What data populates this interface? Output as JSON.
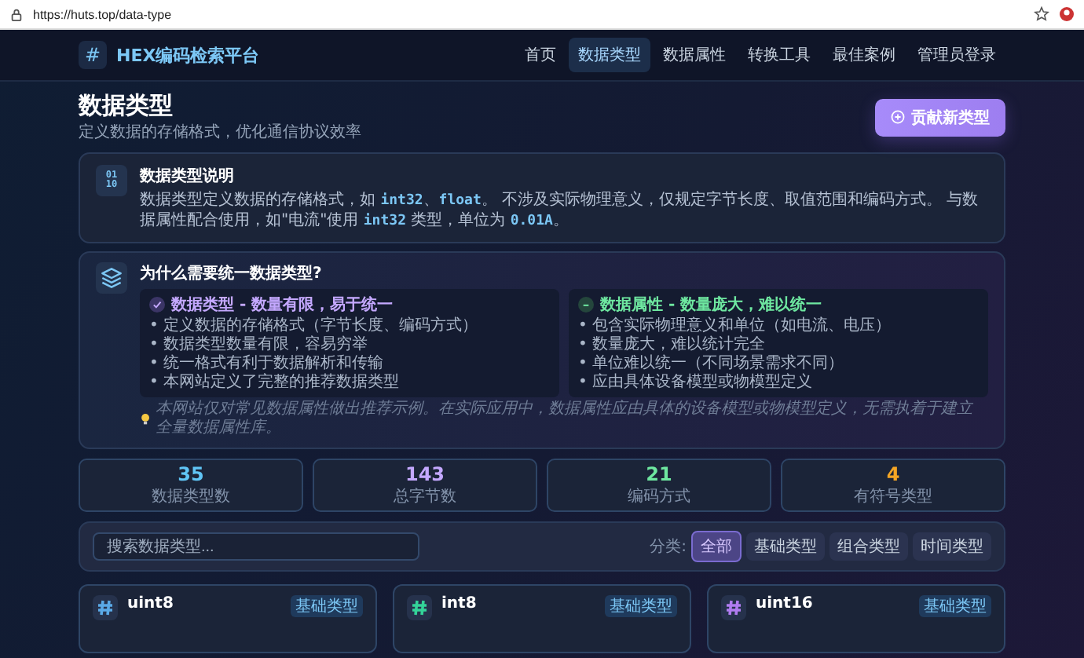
{
  "browser": {
    "url": "https://huts.top/data-type"
  },
  "nav": {
    "logo_icon": "#",
    "logo_text": "HEX编码检索平台",
    "items": [
      {
        "label": "首页",
        "selected": false
      },
      {
        "label": "数据类型",
        "selected": true
      },
      {
        "label": "数据属性",
        "selected": false
      },
      {
        "label": "转换工具",
        "selected": false
      },
      {
        "label": "最佳案例",
        "selected": false
      },
      {
        "label": "管理员登录",
        "selected": false
      }
    ]
  },
  "header": {
    "title": "数据类型",
    "subtitle": "定义数据的存储格式，优化通信协议效率",
    "button": "贡献新类型"
  },
  "info": {
    "icon": "01\n10",
    "title": "数据类型说明",
    "segments": [
      {
        "kind": "plain",
        "text": "数据类型定义数据的存储格式，如 "
      },
      {
        "kind": "code",
        "text": "int32"
      },
      {
        "kind": "plain",
        "text": "、"
      },
      {
        "kind": "code",
        "text": "float"
      },
      {
        "kind": "plain",
        "text": "。 不涉及实际物理意义，仅规定字节长度、取值范围和编码方式。 与数据属性配合使用，如\"电流\"使用 "
      },
      {
        "kind": "code",
        "text": "int32"
      },
      {
        "kind": "plain",
        "text": " 类型，单位为 "
      },
      {
        "kind": "code",
        "text": "0.01A"
      },
      {
        "kind": "plain",
        "text": "。"
      }
    ]
  },
  "why": {
    "title": "为什么需要统一数据类型?",
    "columns": [
      {
        "kind": "good",
        "title": "数据类型 - 数量有限，易于统一",
        "items": [
          "• 定义数据的存储格式（字节长度、编码方式）",
          "• 数据类型数量有限，容易穷举",
          "• 统一格式有利于数据解析和传输",
          "• 本网站定义了完整的推荐数据类型"
        ]
      },
      {
        "kind": "neutral",
        "title": "数据属性 - 数量庞大，难以统一",
        "items": [
          "• 包含实际物理意义和单位（如电流、电压）",
          "• 数量庞大，难以统计完全",
          "• 单位难以统一（不同场景需求不同）",
          "• 应由具体设备模型或物模型定义"
        ]
      }
    ],
    "note": "本网站仅对常见数据属性做出推荐示例。在实际应用中，数据属性应由具体的设备模型或物模型定义，无需执着于建立全量数据属性库。"
  },
  "stats": [
    {
      "value": "35",
      "label": "数据类型数",
      "color": "#60c5f5"
    },
    {
      "value": "143",
      "label": "总字节数",
      "color": "#c4a8ff"
    },
    {
      "value": "21",
      "label": "编码方式",
      "color": "#6ee7a0"
    },
    {
      "value": "4",
      "label": "有符号类型",
      "color": "#f5a524"
    }
  ],
  "filter": {
    "placeholder": "搜索数据类型...",
    "label": "分类:",
    "chips": [
      {
        "label": "全部",
        "selected": true
      },
      {
        "label": "基础类型",
        "selected": false
      },
      {
        "label": "组合类型",
        "selected": false
      },
      {
        "label": "时间类型",
        "selected": false
      }
    ]
  },
  "cards": [
    {
      "name": "uint8",
      "badge": "基础类型",
      "color": "#5aa9e6"
    },
    {
      "name": "int8",
      "badge": "基础类型",
      "color": "#34d399"
    },
    {
      "name": "uint16",
      "badge": "基础类型",
      "color": "#b07cf0"
    }
  ]
}
